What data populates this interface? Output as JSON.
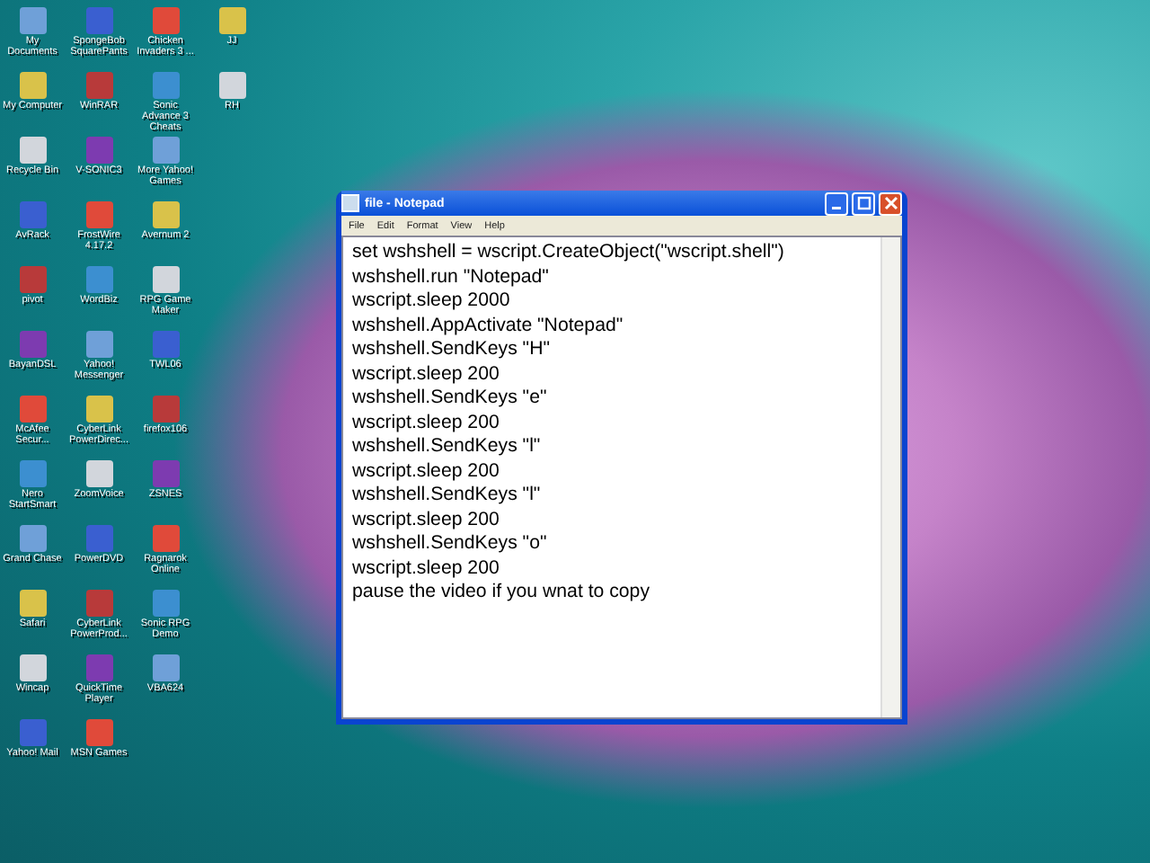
{
  "desktop_columns": [
    [
      {
        "label": "My Documents"
      },
      {
        "label": "My Computer"
      },
      {
        "label": "Recycle Bin"
      },
      {
        "label": "AvRack"
      },
      {
        "label": "pivot"
      },
      {
        "label": "BayanDSL"
      },
      {
        "label": "McAfee Secur..."
      },
      {
        "label": "Nero StartSmart"
      },
      {
        "label": "Grand Chase"
      },
      {
        "label": "Safari"
      },
      {
        "label": "Wincap"
      },
      {
        "label": "Yahoo! Mail"
      }
    ],
    [
      {
        "label": "SpongeBob SquarePants"
      },
      {
        "label": "WinRAR"
      },
      {
        "label": "V-SONIC3"
      },
      {
        "label": "FrostWire 4.17.2"
      },
      {
        "label": "WordBiz"
      },
      {
        "label": "Yahoo! Messenger"
      },
      {
        "label": "CyberLink PowerDirec..."
      },
      {
        "label": "ZoomVoice"
      },
      {
        "label": "PowerDVD"
      },
      {
        "label": "CyberLink PowerProd..."
      },
      {
        "label": "QuickTime Player"
      },
      {
        "label": "MSN Games"
      }
    ],
    [
      {
        "label": "Chicken Invaders 3 ..."
      },
      {
        "label": "Sonic Advance 3 Cheats"
      },
      {
        "label": "More Yahoo! Games"
      },
      {
        "label": "Avernum 2"
      },
      {
        "label": "RPG Game Maker"
      },
      {
        "label": "TWL06"
      },
      {
        "label": "firefox106"
      },
      {
        "label": "ZSNES"
      },
      {
        "label": "Ragnarok Online"
      },
      {
        "label": "Sonic RPG Demo"
      },
      {
        "label": "VBA624"
      }
    ],
    [
      {
        "label": "JJ"
      },
      {
        "label": "RH"
      }
    ]
  ],
  "notepad": {
    "title": "file - Notepad",
    "menu": [
      "File",
      "Edit",
      "Format",
      "View",
      "Help"
    ],
    "lines": [
      "set wshshell = wscript.CreateObject(\"wscript.shell\")",
      "wshshell.run \"Notepad\"",
      "wscript.sleep 2000",
      "wshshell.AppActivate \"Notepad\"",
      "wshshell.SendKeys \"H\"",
      "wscript.sleep 200",
      "wshshell.SendKeys \"e\"",
      "wscript.sleep 200",
      "wshshell.SendKeys \"l\"",
      "wscript.sleep 200",
      "wshshell.SendKeys \"l\"",
      "wscript.sleep 200",
      "wshshell.SendKeys \"o\"",
      "wscript.sleep 200",
      "pause the video if you wnat to copy"
    ]
  }
}
